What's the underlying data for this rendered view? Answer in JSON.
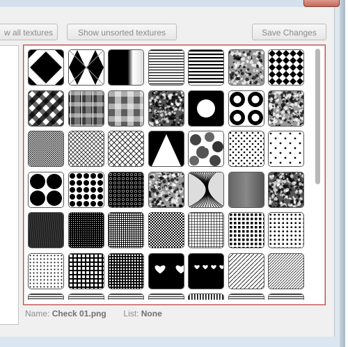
{
  "toolbar": {
    "show_all_label": "w all textures",
    "show_unsorted_label": "Show unsorted textures",
    "save_label": "Save Changes"
  },
  "status": {
    "name_label": "Name:",
    "name_value": "Check 01.png",
    "list_label": "List:",
    "list_value": "None"
  },
  "textures": [
    {
      "pattern": "diamond-check"
    },
    {
      "pattern": "argyle"
    },
    {
      "pattern": "gradient-vertical"
    },
    {
      "pattern": "thin-horizontal-lines"
    },
    {
      "pattern": "thick-horizontal-lines"
    },
    {
      "pattern": "noise-gray"
    },
    {
      "pattern": "checkerboard-diagonal"
    },
    {
      "pattern": "plaid-diagonal"
    },
    {
      "pattern": "plaid-gray"
    },
    {
      "pattern": "plaid-soft"
    },
    {
      "pattern": "crumpled"
    },
    {
      "pattern": "ring-large"
    },
    {
      "pattern": "rings-small"
    },
    {
      "pattern": "crumpled-light"
    },
    {
      "pattern": "fine-crosshatch"
    },
    {
      "pattern": "diagonal-grid"
    },
    {
      "pattern": "diagonal-grid-coarse"
    },
    {
      "pattern": "triangle"
    },
    {
      "pattern": "blobs"
    },
    {
      "pattern": "polka-dots"
    },
    {
      "pattern": "sparse-dots"
    },
    {
      "pattern": "large-dots"
    },
    {
      "pattern": "medium-dots"
    },
    {
      "pattern": "dense-dots"
    },
    {
      "pattern": "noise-medium"
    },
    {
      "pattern": "scribble"
    },
    {
      "pattern": "brushed"
    },
    {
      "pattern": "crinkle"
    },
    {
      "pattern": "streaks"
    },
    {
      "pattern": "fine-grid-dark"
    },
    {
      "pattern": "dense-grid"
    },
    {
      "pattern": "halftone"
    },
    {
      "pattern": "fine-dots-grid"
    },
    {
      "pattern": "square-grid"
    },
    {
      "pattern": "small-square-grid"
    },
    {
      "pattern": "small-dots"
    },
    {
      "pattern": "window-grid"
    },
    {
      "pattern": "fine-window-grid"
    },
    {
      "pattern": "hearts-large"
    },
    {
      "pattern": "hearts-small"
    },
    {
      "pattern": "diagonal-lines"
    },
    {
      "pattern": "diagonal-lines-dense"
    },
    {
      "pattern": "stripes-partial"
    },
    {
      "pattern": "stripes-partial"
    },
    {
      "pattern": "stripes-partial"
    },
    {
      "pattern": "stripes-partial"
    },
    {
      "pattern": "stripes-vertical-partial"
    },
    {
      "pattern": "stripes-partial"
    },
    {
      "pattern": "stripes-partial"
    }
  ]
}
